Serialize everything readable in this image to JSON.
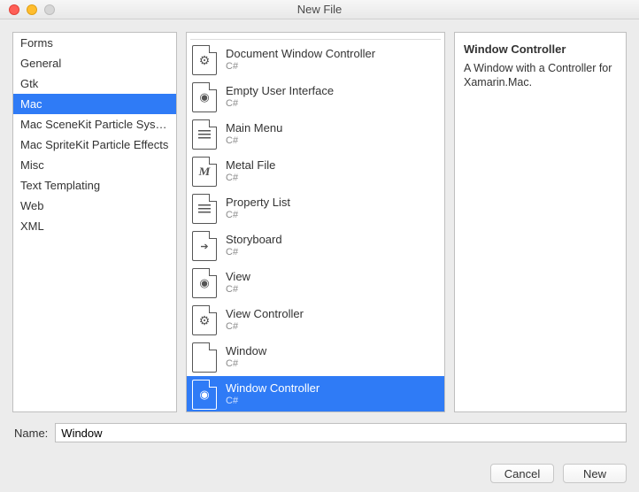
{
  "window": {
    "title": "New File"
  },
  "categories": [
    {
      "label": "Forms",
      "selected": false
    },
    {
      "label": "General",
      "selected": false
    },
    {
      "label": "Gtk",
      "selected": false
    },
    {
      "label": "Mac",
      "selected": true
    },
    {
      "label": "Mac SceneKit Particle Systems",
      "selected": false
    },
    {
      "label": "Mac SpriteKit Particle Effects",
      "selected": false
    },
    {
      "label": "Misc",
      "selected": false
    },
    {
      "label": "Text Templating",
      "selected": false
    },
    {
      "label": "Web",
      "selected": false
    },
    {
      "label": "XML",
      "selected": false
    }
  ],
  "templates": [
    {
      "label": "Document Window Controller",
      "sub": "C#",
      "icon": "gear",
      "selected": false
    },
    {
      "label": "Empty User Interface",
      "sub": "C#",
      "icon": "eye",
      "selected": false
    },
    {
      "label": "Main Menu",
      "sub": "C#",
      "icon": "lines",
      "selected": false
    },
    {
      "label": "Metal File",
      "sub": "C#",
      "icon": "metal",
      "selected": false
    },
    {
      "label": "Property List",
      "sub": "C#",
      "icon": "lines",
      "selected": false
    },
    {
      "label": "Storyboard",
      "sub": "C#",
      "icon": "arrow",
      "selected": false
    },
    {
      "label": "View",
      "sub": "C#",
      "icon": "eye",
      "selected": false
    },
    {
      "label": "View Controller",
      "sub": "C#",
      "icon": "gear",
      "selected": false
    },
    {
      "label": "Window",
      "sub": "C#",
      "icon": "blank",
      "selected": false
    },
    {
      "label": "Window Controller",
      "sub": "C#",
      "icon": "eye",
      "selected": true
    }
  ],
  "details": {
    "title": "Window Controller",
    "description": "A Window with a Controller for Xamarin.Mac."
  },
  "name_field": {
    "label": "Name:",
    "value": "Window"
  },
  "buttons": {
    "cancel": "Cancel",
    "new": "New"
  }
}
